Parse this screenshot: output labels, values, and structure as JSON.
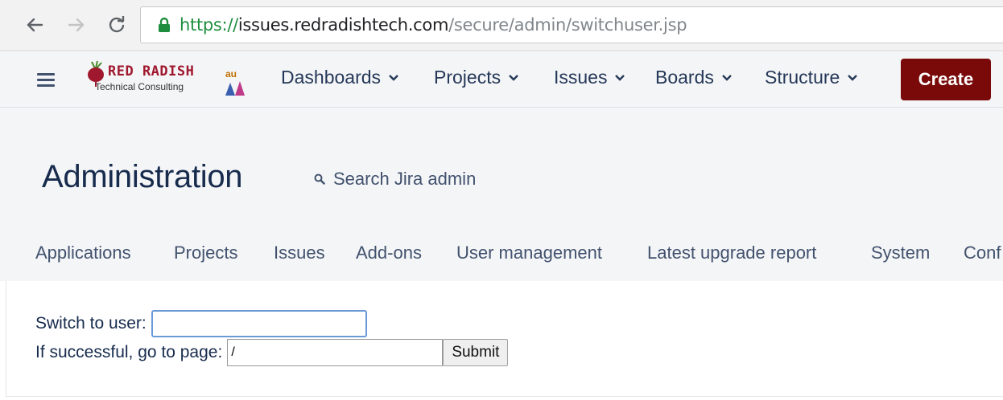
{
  "browser": {
    "url_scheme": "https://",
    "url_host": "issues.redradishtech.com",
    "url_path": "/secure/admin/switchuser.jsp",
    "icons": [
      "back-arrow-icon",
      "forward-arrow-icon",
      "reload-icon",
      "lock-icon"
    ]
  },
  "header": {
    "logo_line1": "RED RADISH",
    "logo_line2": "Technical Consulting",
    "logo_suffix": "au",
    "nav": [
      "Dashboards",
      "Projects",
      "Issues",
      "Boards",
      "Structure"
    ],
    "create_label": "Create",
    "colors": {
      "create_bg": "#7a0a0a",
      "brand_red": "#a0182e"
    }
  },
  "admin": {
    "title": "Administration",
    "search_label": "Search Jira admin",
    "tabs": [
      "Applications",
      "Projects",
      "Issues",
      "Add-ons",
      "User management",
      "Latest upgrade report",
      "System",
      "Conf"
    ]
  },
  "form": {
    "switch_label": "Switch to user:",
    "switch_value": "",
    "goto_label": "If successful, go to page:",
    "goto_value": "/",
    "submit_label": "Submit"
  }
}
